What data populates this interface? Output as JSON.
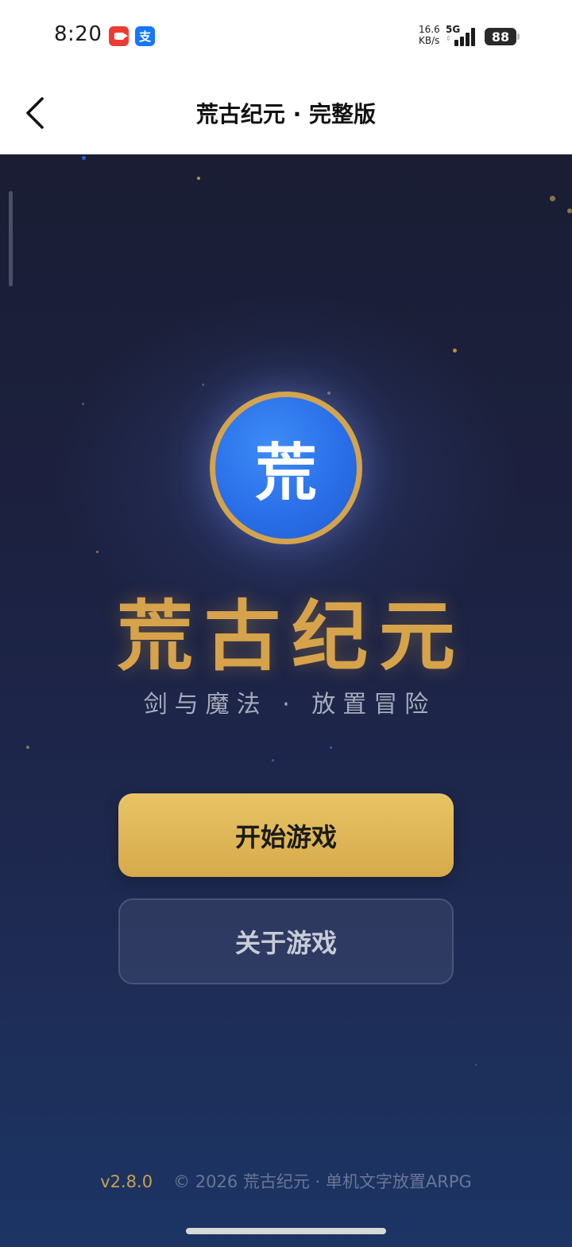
{
  "status_bar": {
    "time": "8:20",
    "alipay_badge": "支",
    "net_speed_value": "16.6",
    "net_speed_unit": "KB/s",
    "network_type": "5G",
    "battery": "88",
    "icons": [
      "video-app-icon",
      "alipay-icon",
      "signal-icon",
      "battery-icon"
    ]
  },
  "header": {
    "title": "荒古纪元 · 完整版",
    "back_icon": "chevron-left-icon"
  },
  "game": {
    "emblem_char": "荒",
    "title": "荒古纪元",
    "subtitle": "剑与魔法 · 放置冒险",
    "start_button": "开始游戏",
    "about_button": "关于游戏",
    "version": "v2.8.0",
    "copyright": "© 2026 荒古纪元 · 单机文字放置ARPG"
  },
  "colors": {
    "accent_gold": "#d6a34a",
    "emblem_blue": "#2a6fe9",
    "background_top": "#1a1d33",
    "background_bottom": "#1c3565"
  }
}
